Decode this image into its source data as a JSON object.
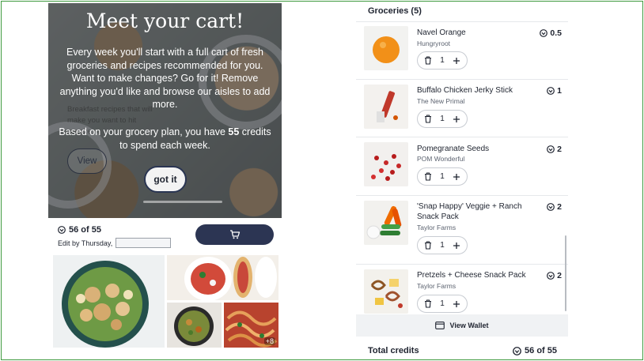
{
  "hero": {
    "title": "Meet your cart!",
    "body": "Every week you'll start with a full cart of fresh groceries and recipes recommended for you. Want to make changes? Go for it! Remove anything you'd like and browse our aisles to add more.",
    "credits_prefix": "Based on your grocery plan, you have ",
    "credits_value": "55",
    "credits_suffix": " credits to spend each week.",
    "ghost_text": "Breakfast recipes that will make you want to hit snooze.",
    "view_label": "View",
    "gotit_label": "got it"
  },
  "cart_summary": {
    "credits_used": "56 of 55",
    "edit_by": "Edit by Thursday,"
  },
  "recipe_tiles": {
    "more_count": "+8"
  },
  "groceries": {
    "header": "Groceries (5)",
    "items": [
      {
        "name": "Navel Orange",
        "brand": "Hungryroot",
        "credits": "0.5",
        "qty": "1"
      },
      {
        "name": "Buffalo Chicken Jerky Stick",
        "brand": "The New Primal",
        "credits": "1",
        "qty": "1"
      },
      {
        "name": "Pomegranate Seeds",
        "brand": "POM Wonderful",
        "credits": "2",
        "qty": "1"
      },
      {
        "name": "'Snap Happy' Veggie + Ranch Snack Pack",
        "brand": "Taylor Farms",
        "credits": "2",
        "qty": "1"
      },
      {
        "name": "Pretzels + Cheese Snack Pack",
        "brand": "Taylor Farms",
        "credits": "2",
        "qty": "1"
      }
    ]
  },
  "wallet": {
    "label": "View Wallet"
  },
  "total": {
    "label": "Total credits",
    "value": "56 of 55"
  },
  "colors": {
    "accent_navy": "#2c3553",
    "frame_green": "#3f9a3f"
  }
}
